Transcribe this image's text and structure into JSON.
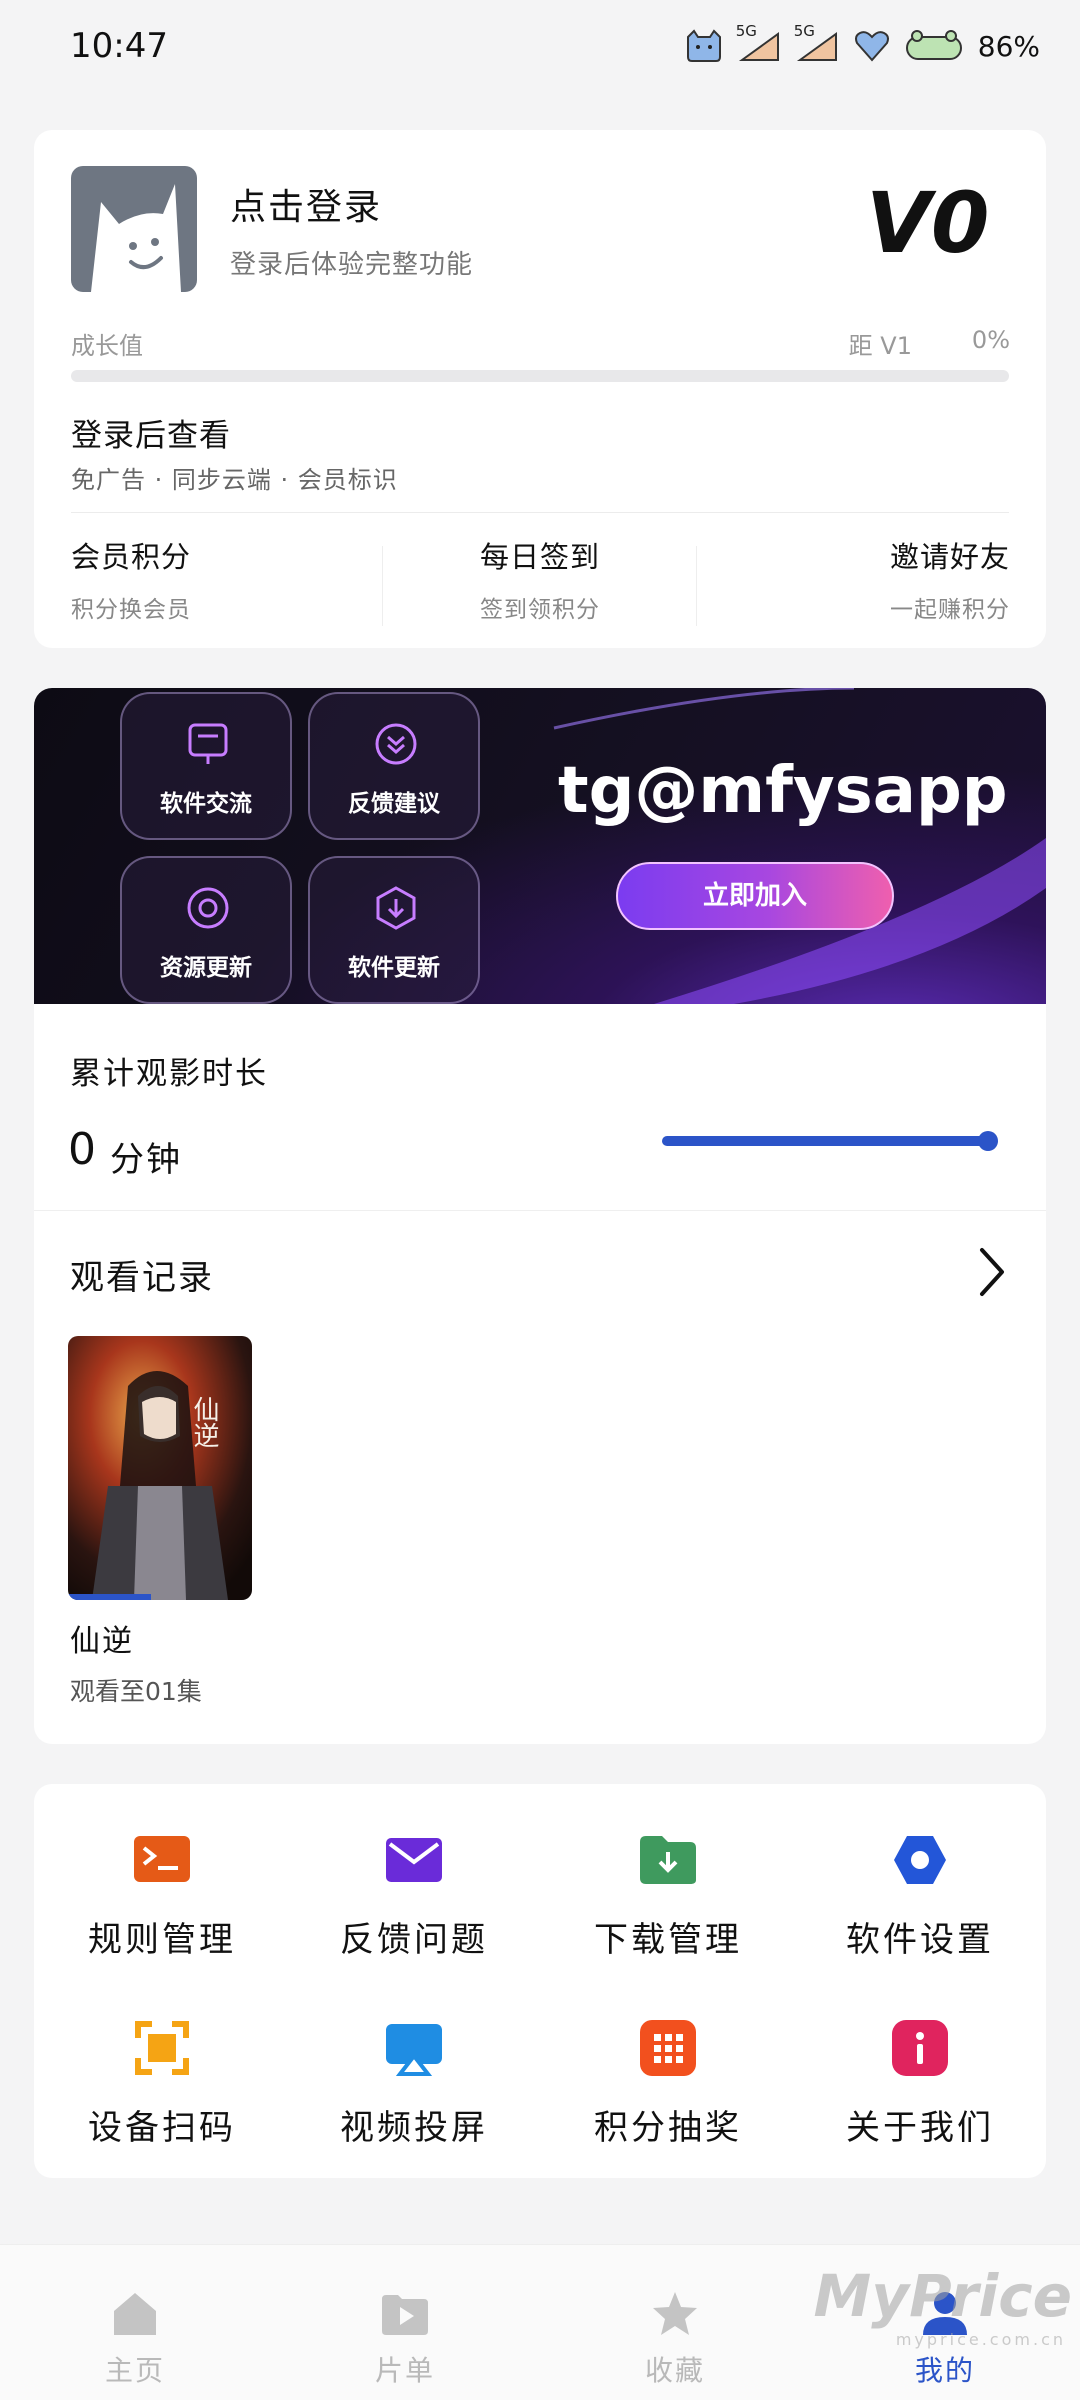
{
  "status_bar": {
    "time": "10:47",
    "network_a": "5G",
    "network_b": "5G",
    "battery": "86%"
  },
  "login": {
    "title": "点击登录",
    "subtitle": "登录后体验完整功能",
    "vip_level": "V0",
    "growth_label": "成长值",
    "growth_target": "距 V1",
    "growth_percent": "0%",
    "growth_progress": 0,
    "view_title": "登录后查看",
    "view_perks": "免广告 · 同步云端 · 会员标识",
    "actions": [
      {
        "title": "会员积分",
        "subtitle": "积分换会员"
      },
      {
        "title": "每日签到",
        "subtitle": "签到领积分"
      },
      {
        "title": "邀请好友",
        "subtitle": "一起赚积分"
      }
    ]
  },
  "banner": {
    "tiles": [
      {
        "label": "软件交流",
        "icon": "chat-box-icon"
      },
      {
        "label": "反馈建议",
        "icon": "double-chevron-icon"
      },
      {
        "label": "资源更新",
        "icon": "target-icon"
      },
      {
        "label": "软件更新",
        "icon": "shield-download-icon"
      }
    ],
    "handle": "tg@mfysapp",
    "join_label": "立即加入"
  },
  "watch_time": {
    "title": "累计观影时长",
    "value": "0",
    "unit": "分钟",
    "accent": "#2b54c8"
  },
  "history": {
    "title": "观看记录",
    "items": [
      {
        "title": "仙逆",
        "poster_text": "仙逆",
        "progress": "观看至01集",
        "watched_fraction": 0.45
      }
    ]
  },
  "tools": [
    {
      "label": "规则管理",
      "icon": "terminal-icon",
      "color": "#e55a17"
    },
    {
      "label": "反馈问题",
      "icon": "mail-icon",
      "color": "#6a2bd9"
    },
    {
      "label": "下载管理",
      "icon": "folder-download-icon",
      "color": "#3f9a5e"
    },
    {
      "label": "软件设置",
      "icon": "hex-settings-icon",
      "color": "#2356d8"
    },
    {
      "label": "设备扫码",
      "icon": "scan-icon",
      "color": "#f5a414"
    },
    {
      "label": "视频投屏",
      "icon": "cast-icon",
      "color": "#1f8de3"
    },
    {
      "label": "积分抽奖",
      "icon": "grid-icon",
      "color": "#f2501e"
    },
    {
      "label": "关于我们",
      "icon": "info-icon",
      "color": "#e0245e"
    }
  ],
  "bottom_nav": [
    {
      "label": "主页",
      "icon": "home-icon",
      "active": false
    },
    {
      "label": "片单",
      "icon": "playlist-icon",
      "active": false
    },
    {
      "label": "收藏",
      "icon": "star-icon",
      "active": false
    },
    {
      "label": "我的",
      "icon": "person-icon",
      "active": true
    }
  ],
  "watermark": {
    "brand": "MyPrice",
    "url": "myprice.com.cn"
  }
}
